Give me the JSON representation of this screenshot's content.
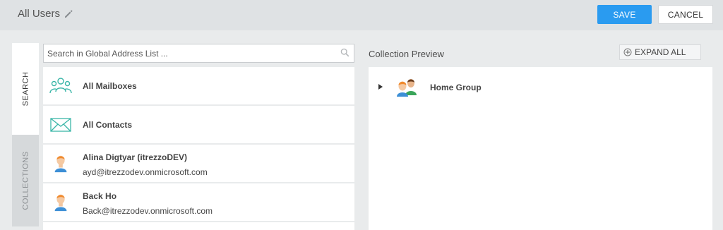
{
  "header": {
    "title": "All Users",
    "save_label": "SAVE",
    "cancel_label": "CANCEL"
  },
  "tabs": {
    "search": "SEARCH",
    "collections": "COLLECTIONS"
  },
  "search": {
    "placeholder": "Search in Global Address List ..."
  },
  "list": {
    "items": [
      {
        "label": "All Mailboxes",
        "icon": "mailboxes-group-icon"
      },
      {
        "label": "All Contacts",
        "icon": "envelope-icon"
      },
      {
        "label": "Alina Digtyar (itrezzoDEV)",
        "sub": "ayd@itrezzodev.onmicrosoft.com",
        "icon": "user-avatar-icon"
      },
      {
        "label": "Back Ho",
        "sub": "Back@itrezzodev.onmicrosoft.com",
        "icon": "user-avatar-icon"
      }
    ]
  },
  "preview": {
    "title": "Collection Preview",
    "expand_label": "EXPAND ALL",
    "tree": [
      {
        "label": "Home Group",
        "icon": "group-avatar-icon"
      }
    ]
  },
  "colors": {
    "accent": "#2a9bf0",
    "teal_icon": "#3bb6a8",
    "header_bg": "#dfe2e4"
  }
}
